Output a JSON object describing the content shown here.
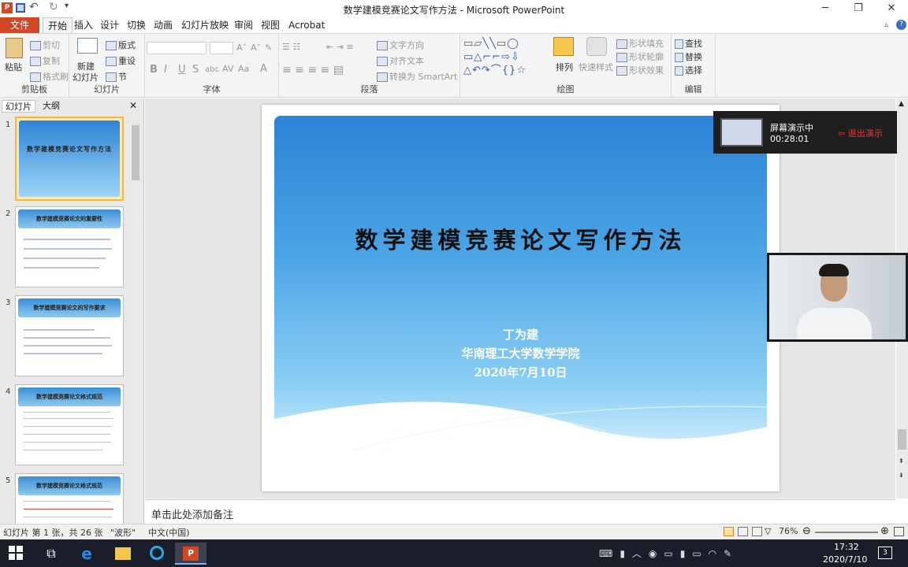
{
  "window": {
    "title": "数学建模竞赛论文写作方法 - Microsoft PowerPoint"
  },
  "tabs": [
    "文件",
    "开始",
    "插入",
    "设计",
    "切换",
    "动画",
    "幻灯片放映",
    "审阅",
    "视图",
    "Acrobat"
  ],
  "ribbon": {
    "clipboard": {
      "label": "剪贴板",
      "paste": "粘贴",
      "cut": "剪切",
      "copy": "复制",
      "format_painter": "格式刷"
    },
    "slides": {
      "label": "幻灯片",
      "new_slide": "新建",
      "new_slide2": "幻灯片",
      "layout": "版式",
      "reset": "重设",
      "section": "节"
    },
    "font": {
      "label": "字体",
      "bold": "B",
      "italic": "I",
      "underline": "U",
      "strike": "S",
      "shadow": "abc",
      "spacing": "AV",
      "case": "Aa"
    },
    "paragraph": {
      "label": "段落",
      "text_direction": "文字方向",
      "align_text": "对齐文本",
      "smartart": "转换为 SmartArt"
    },
    "drawing": {
      "label": "绘图",
      "arrange": "排列",
      "quick_styles": "快速样式",
      "fill": "形状填充",
      "outline": "形状轮廓",
      "effects": "形状效果"
    },
    "editing": {
      "label": "编辑",
      "find": "查找",
      "replace": "替换",
      "select": "选择"
    }
  },
  "panel": {
    "tab_slides": "幻灯片",
    "tab_outline": "大纲"
  },
  "thumbnails": [
    {
      "num": "1",
      "title": "数学建模竞赛论文写作方法"
    },
    {
      "num": "2",
      "title": "数学建模竞赛论文的重要性"
    },
    {
      "num": "3",
      "title": "数学建模竞赛论文的写作要求"
    },
    {
      "num": "4",
      "title": "数学建模竞赛论文格式规范"
    },
    {
      "num": "5",
      "title": "数学建模竞赛论文格式规范"
    }
  ],
  "slide": {
    "title": "数学建模竞赛论文写作方法",
    "author": "丁为建",
    "affiliation": "华南理工大学数学学院",
    "date": "2020年7月10日"
  },
  "notes": {
    "placeholder": "单击此处添加备注"
  },
  "statusbar": {
    "slide_info": "幻灯片 第 1 张，共 26 张",
    "theme": "\"波形\"",
    "language": "中文(中国)",
    "zoom": "76%"
  },
  "share": {
    "status": "屏幕演示中",
    "elapsed": "00:28:01",
    "exit": "退出演示"
  },
  "taskbar": {
    "time": "17:32",
    "date": "2020/7/10",
    "notifications": "3"
  },
  "colors": {
    "file_tab": "#d24726",
    "slide_gradient_top": "#2d83d6",
    "slide_gradient_bottom": "#d8f0fc",
    "exit_red": "#e03b3b"
  }
}
